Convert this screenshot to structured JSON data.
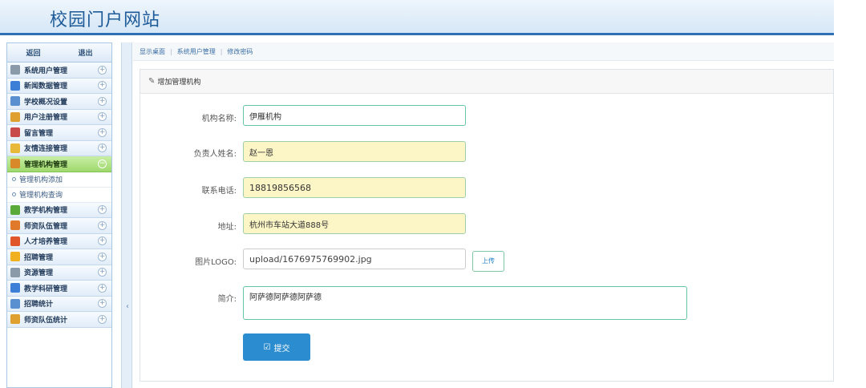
{
  "header": {
    "title": "校园门户网站"
  },
  "sidebar": {
    "back_label": "返回",
    "logout_label": "退出",
    "menu": [
      {
        "label": "系统用户管理",
        "icon": "gear-icon",
        "color": "#8a9aa8"
      },
      {
        "label": "新闻数据管理",
        "icon": "monitor-icon",
        "color": "#3d7fd6"
      },
      {
        "label": "学校概况设置",
        "icon": "table-icon",
        "color": "#5a8fd0"
      },
      {
        "label": "用户注册管理",
        "icon": "user-icon",
        "color": "#e0a030"
      },
      {
        "label": "留言管理",
        "icon": "message-icon",
        "color": "#c94a4a"
      },
      {
        "label": "友情连接管理",
        "icon": "folder-icon",
        "color": "#e8b838"
      },
      {
        "label": "管理机构管理",
        "icon": "chart-icon",
        "color": "#d88a2a"
      },
      {
        "label": "教学机构管理",
        "icon": "board-icon",
        "color": "#5aaa3a"
      },
      {
        "label": "师资队伍管理",
        "icon": "calendar-icon",
        "color": "#e07a2a"
      },
      {
        "label": "人才培养管理",
        "icon": "s-icon",
        "color": "#e0552a"
      },
      {
        "label": "招聘管理",
        "icon": "badge-icon",
        "color": "#f0b020"
      },
      {
        "label": "资源管理",
        "icon": "gear-icon",
        "color": "#8a9aa8"
      },
      {
        "label": "教学科研管理",
        "icon": "monitor-icon",
        "color": "#3d7fd6"
      },
      {
        "label": "招聘统计",
        "icon": "table-icon",
        "color": "#5a8fd0"
      },
      {
        "label": "师资队伍统计",
        "icon": "user-icon",
        "color": "#e0a030"
      }
    ],
    "submenu": [
      {
        "label": "管理机构添加"
      },
      {
        "label": "管理机构查询"
      }
    ],
    "collapsed_toggle": "+",
    "expanded_toggle": "−"
  },
  "breadcrumb": [
    {
      "label": "显示桌面"
    },
    {
      "label": "系统用户管理"
    },
    {
      "label": "修改密码"
    }
  ],
  "breadcrumb_sep": "|",
  "panel": {
    "title": "增加管理机构",
    "icon": "edit-icon"
  },
  "form": {
    "name_label": "机构名称:",
    "name_value": "伊雁机构",
    "leader_label": "负责人姓名:",
    "leader_value": "赵一恩",
    "phone_label": "联系电话:",
    "phone_value": "18819856568",
    "address_label": "地址:",
    "address_value": "杭州市车站大道888号",
    "logo_label": "图片LOGO:",
    "logo_value": "upload/1676975769902.jpg",
    "upload_label": "上传",
    "intro_label": "简介:",
    "intro_value": "阿萨德阿萨德阿萨德",
    "submit_label": "提交"
  },
  "colors": {
    "accent": "#2b8ccf",
    "header_border": "#2f6fb3",
    "active_menu": "#9fd86d"
  }
}
